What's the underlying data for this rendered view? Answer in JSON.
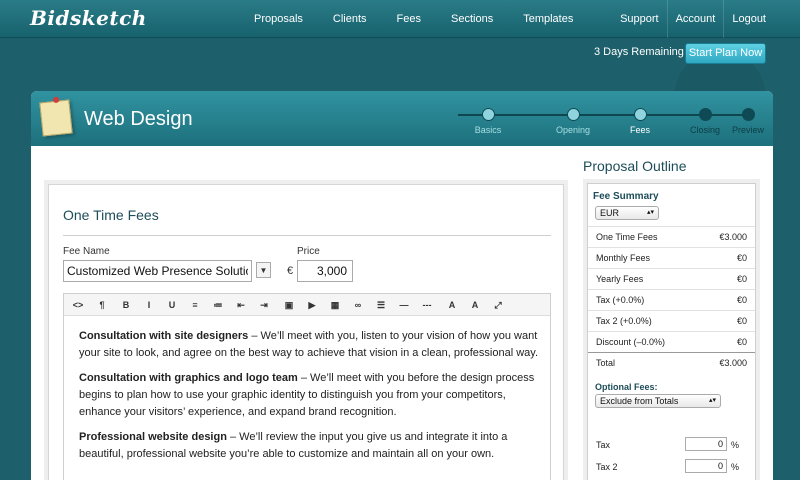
{
  "app": {
    "logo": "Bidsketch"
  },
  "nav": {
    "left": [
      "Proposals",
      "Clients",
      "Fees",
      "Sections",
      "Templates"
    ],
    "right": [
      "Support",
      "Account",
      "Logout"
    ]
  },
  "trial": {
    "text": "3 Days Remaining",
    "button": "Start Plan Now"
  },
  "page": {
    "title": "Web Design"
  },
  "steps": [
    {
      "label": "Basics",
      "state": "done"
    },
    {
      "label": "Opening",
      "state": "done"
    },
    {
      "label": "Fees",
      "state": "active"
    },
    {
      "label": "Closing",
      "state": "todo"
    },
    {
      "label": "Preview",
      "state": "todo"
    }
  ],
  "fee_form": {
    "section_title": "One Time Fees",
    "fee_name_label": "Fee Name",
    "fee_name_value": "Customized Web Presence Solution",
    "price_label": "Price",
    "currency_symbol": "€",
    "price_value": "3,000"
  },
  "toolbar_icons": [
    "code-icon",
    "paragraph-icon",
    "bold-icon",
    "italic-icon",
    "underline-icon",
    "ordered-list-icon",
    "unordered-list-icon",
    "outdent-icon",
    "indent-icon",
    "image-icon",
    "video-icon",
    "table-icon",
    "link-icon",
    "align-icon",
    "horizontal-rule-icon",
    "dashed-rule-icon",
    "font-color-icon",
    "background-color-icon",
    "fullscreen-icon"
  ],
  "toolbar_glyphs": [
    "<>",
    "¶",
    "B",
    "I",
    "U",
    "≡",
    "≔",
    "⇤",
    "⇥",
    "▣",
    "▶",
    "▦",
    "∞",
    "☰",
    "—",
    "---",
    "A",
    "A",
    "⤢"
  ],
  "editor": {
    "paragraphs": [
      {
        "bold": "Consultation with site designers",
        "text": " – We’ll meet with you, listen to your vision of how you want your site to look, and agree on the best way to achieve that vision in a clean, professional way."
      },
      {
        "bold": "Consultation with graphics and logo team",
        "text": " – We’ll meet with you before the design process begins to plan how to use your graphic identity to distinguish you from your competitors, enhance your visitors’ experience, and expand brand recognition."
      },
      {
        "bold": "Professional website design",
        "text": " – We’ll review the input you give us and integrate it into a beautiful, professional website you’re able to customize and maintain all on your own."
      }
    ]
  },
  "sidebar": {
    "title": "Proposal Outline",
    "fee_summary_title": "Fee Summary",
    "currency": "EUR",
    "rows": [
      {
        "label": "One Time Fees",
        "value": "€3.000"
      },
      {
        "label": "Monthly Fees",
        "value": "€0"
      },
      {
        "label": "Yearly Fees",
        "value": "€0"
      },
      {
        "label": "Tax (+0.0%)",
        "value": "€0"
      },
      {
        "label": "Tax 2 (+0.0%)",
        "value": "€0"
      },
      {
        "label": "Discount (–0.0%)",
        "value": "€0"
      },
      {
        "label": "Total",
        "value": "€3.000"
      }
    ],
    "optional_fees_label": "Optional Fees:",
    "optional_fees_value": "Exclude from Totals",
    "taxes": [
      {
        "label": "Tax",
        "value": "0",
        "unit": "%"
      },
      {
        "label": "Tax 2",
        "value": "0",
        "unit": "%"
      }
    ]
  }
}
